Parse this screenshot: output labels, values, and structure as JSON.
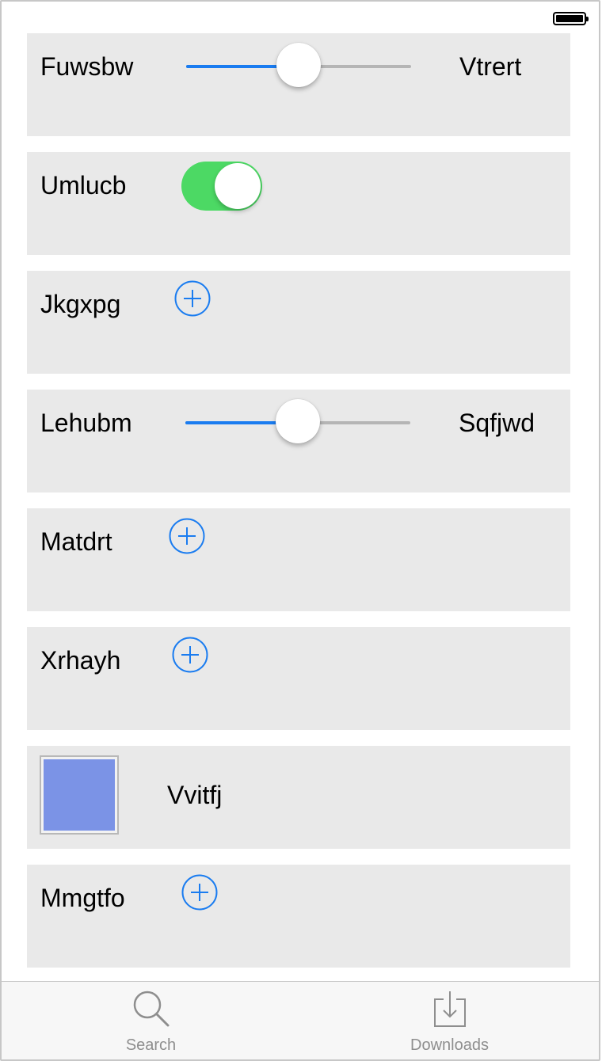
{
  "colors": {
    "card_bg": "#e9e9e9",
    "accent_blue": "#1a7cf0",
    "toggle_on": "#4cd964",
    "swatch": "#7b93e6",
    "tab_inactive": "#8e8e8e"
  },
  "rows": [
    {
      "type": "slider",
      "label": "Fuwsbw",
      "end_label": "Vtrert",
      "value_fraction": 0.5
    },
    {
      "type": "toggle",
      "label": "Umlucb",
      "on": true
    },
    {
      "type": "add",
      "label": "Jkgxpg",
      "icon": "plus-circle-icon"
    },
    {
      "type": "slider",
      "label": "Lehubm",
      "end_label": "Sqfjwd",
      "value_fraction": 0.5
    },
    {
      "type": "add",
      "label": "Matdrt",
      "icon": "plus-circle-icon"
    },
    {
      "type": "add",
      "label": "Xrhayh",
      "icon": "plus-circle-icon"
    },
    {
      "type": "swatch",
      "label": "Vvitfj"
    },
    {
      "type": "add",
      "label": "Mmgtfo",
      "icon": "plus-circle-icon"
    }
  ],
  "tabbar": {
    "tabs": [
      {
        "label": "Search",
        "icon": "search-icon"
      },
      {
        "label": "Downloads",
        "icon": "downloads-icon"
      }
    ]
  }
}
